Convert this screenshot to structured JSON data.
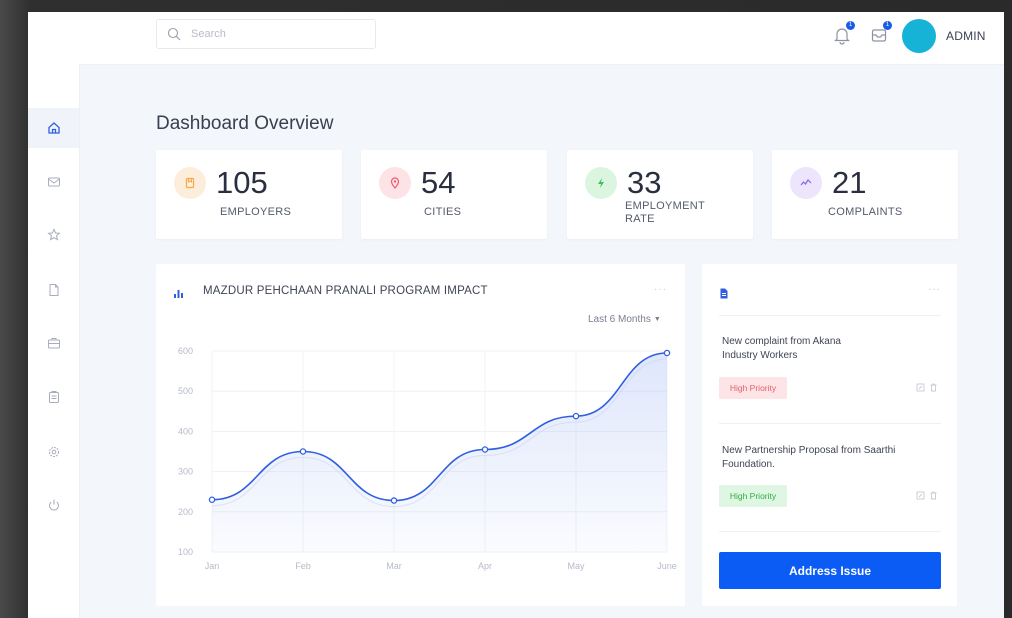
{
  "header": {
    "search_placeholder": "Search",
    "notification_badge": "1",
    "messages_badge": "1",
    "user_name": "ADMIN",
    "avatar_color": "#16b3d6"
  },
  "sidebar": {
    "items": [
      {
        "icon": "home-icon",
        "active": true
      },
      {
        "icon": "mail-icon",
        "active": false
      },
      {
        "icon": "star-icon",
        "active": false
      },
      {
        "icon": "document-icon",
        "active": false
      },
      {
        "icon": "briefcase-icon",
        "active": false
      },
      {
        "icon": "clipboard-icon",
        "active": false
      },
      {
        "icon": "settings-icon",
        "active": false
      },
      {
        "icon": "power-icon",
        "active": false
      }
    ]
  },
  "page_title": "Dashboard Overview",
  "stats": [
    {
      "value": "105",
      "label": "EMPLOYERS",
      "icon": "bookmark-icon",
      "color": "#f5a847",
      "bg": "#fdeedb"
    },
    {
      "value": "54",
      "label": "CITIES",
      "icon": "location-pin-icon",
      "color": "#ef5b6e",
      "bg": "#fde3e6"
    },
    {
      "value": "33",
      "label_line1": "EMPLOYMENT",
      "label_line2": "RATE",
      "icon": "lightning-icon",
      "color": "#3ec35a",
      "bg": "#dcf5e1"
    },
    {
      "value": "21",
      "label": "COMPLAINTS",
      "icon": "activity-icon",
      "color": "#8a63e8",
      "bg": "#ece5fb"
    }
  ],
  "chart_card": {
    "title": "MAZDUR PEHCHAAN PRANALI PROGRAM IMPACT",
    "range_label": "Last 6 Months",
    "more": "···"
  },
  "chart_data": {
    "type": "area",
    "categories": [
      "Jan",
      "Feb",
      "Mar",
      "Apr",
      "May",
      "June"
    ],
    "series": [
      {
        "values": [
          230,
          350,
          228,
          355,
          438,
          595
        ],
        "color": "#2f5fe0"
      }
    ],
    "yticks": [
      100,
      200,
      300,
      400,
      500,
      600
    ],
    "ylim": [
      100,
      600
    ],
    "grid": true,
    "title": "",
    "xlabel": "",
    "ylabel": ""
  },
  "notifications": {
    "more": "···",
    "items": [
      {
        "line1": "New complaint from Akana",
        "line2": "Industry Workers",
        "priority": "High Priority",
        "priority_color": "red"
      },
      {
        "line1": "New Partnership Proposal from Saarthi",
        "line2": "Foundation.",
        "priority": "High Priority",
        "priority_color": "green"
      }
    ],
    "button_label": "Address Issue",
    "button_color": "#0a5cf5"
  }
}
